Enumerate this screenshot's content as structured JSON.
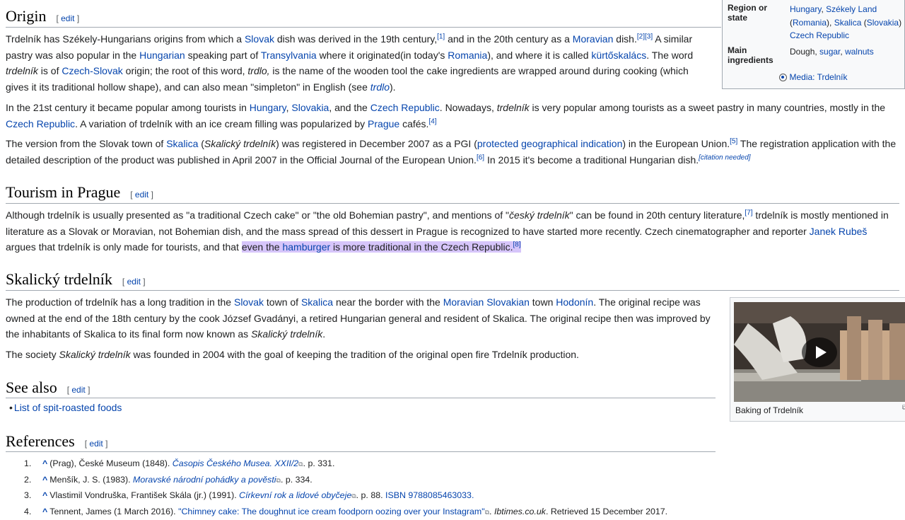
{
  "infobox": {
    "region_label": "Region or state",
    "region_values": [
      "Hungary",
      ", ",
      "Székely Land",
      " (",
      "Romania",
      "), ",
      "Skalica",
      " (",
      "Slovakia",
      ")",
      "Czech Republic"
    ],
    "ingredients_label": "Main ingredients",
    "ingredients_plain": "Dough, ",
    "ingredients_links": [
      "sugar",
      "walnuts"
    ],
    "ingredients_sep": ", ",
    "media": "Media: Trdelník"
  },
  "origin": {
    "heading": "Origin",
    "edit": "edit",
    "p1": {
      "t1": "Trdelník has Székely-Hungarians origins from which a ",
      "l1": "Slovak",
      "t2": " dish was derived in the 19th century,",
      "s1": "[1]",
      "t3": " and in the 20th century as a ",
      "l2": "Moravian",
      "t4": " dish.",
      "s2": "[2]",
      "s3": "[3]",
      "t5": " A similar pastry was also popular in the ",
      "l3": "Hungarian",
      "t6": " speaking part of ",
      "l4": "Transylvania",
      "t7": " where it originated(in today's ",
      "l5": "Romania",
      "t8": "), and where it is called ",
      "l6": "kürtőskalács",
      "t9": ". The word ",
      "i1": "trdelník",
      "t10": " is of ",
      "l7": "Czech-Slovak",
      "t11": " origin; the root of this word, ",
      "i2": "trdlo,",
      "t12": " is the name of the wooden tool the cake ingredients are wrapped around during cooking (which gives it its traditional hollow shape), and can also mean \"simpleton\" in English (see ",
      "l8": "trdlo",
      "t13": ")."
    },
    "p2": {
      "t1": "In the 21st century it became popular among tourists in ",
      "l1": "Hungary",
      "c1": ", ",
      "l2": "Slovakia",
      "t2": ", and the ",
      "l3": "Czech Republic",
      "t3": ". Nowadays, ",
      "i1": "trdelník",
      "t4": " is very popular among tourists as a sweet pastry in many countries, mostly in the ",
      "l4": "Czech Republic",
      "t5": ". A variation of trdelník with an ice cream filling was popularized by ",
      "l5": "Prague",
      "t6": " cafés.",
      "s1": "[4]"
    },
    "p3": {
      "t1": "The version from the Slovak town of ",
      "l1": "Skalica",
      "t2": " (",
      "i1": "Skalický trdelník",
      "t3": ") was registered in December 2007 as a PGI (",
      "l2": "protected geographical indication",
      "t4": ") in the European Union.",
      "s1": "[5]",
      "t5": " The registration application with the detailed description of the product was published in April 2007 in the Official Journal of the European Union.",
      "s2": "[6]",
      "t6": " In 2015 it's become a traditional Hungarian dish.",
      "s3": "[citation needed]"
    }
  },
  "tourism": {
    "heading": "Tourism in Prague",
    "edit": "edit",
    "p1": {
      "t1": "Although trdelník is usually presented as \"a traditional Czech cake\" or \"the old Bohemian pastry\", and mentions of \"",
      "i1": "český trdelník",
      "t2": "\" can be found in 20th century literature,",
      "s1": "[7]",
      "t3": " trdelník is mostly mentioned in literature as a Slovak or Moravian, not Bohemian dish, and the mass spread of this dessert in Prague is recognized to have started more recently. Czech cinematographer and reporter ",
      "l1": "Janek Rubeš",
      "t4": " argues that trdelník is only made for tourists, and that ",
      "h1": "even the ",
      "hl": "hamburger",
      "h2": " is more traditional in the Czech Republic.",
      "s2": "[8]"
    }
  },
  "skalicky": {
    "heading": "Skalický trdelník",
    "edit": "edit",
    "p1": {
      "t1": "The production of trdelník has a long tradition in the ",
      "l1": "Slovak",
      "t2": " town of ",
      "l2": "Skalica",
      "t3": " near the border with the ",
      "l3": "Moravian Slovakian",
      "t4": " town ",
      "l4": "Hodonín",
      "t5": ". The original recipe was owned at the end of the 18th century by the cook József Gvadányi, a retired Hungarian general and resident of Skalica. The original recipe then was improved by the inhabitants of Skalica to its final form now known as ",
      "i1": "Skalický trdelník",
      "t6": "."
    },
    "p2": {
      "t1": "The society ",
      "i1": "Skalický trdelník",
      "t2": " was founded in 2004 with the goal of keeping the tradition of the original open fire Trdelník production."
    },
    "video_caption": "Baking of Trdelník"
  },
  "see_also": {
    "heading": "See also",
    "edit": "edit",
    "items": [
      "List of spit-roasted foods"
    ]
  },
  "references": {
    "heading": "References",
    "edit": "edit",
    "items": [
      {
        "num": "1.",
        "caret": "^",
        "pre": "(Prag), České Museum (1848). ",
        "title": "Časopis Českého Musea. XXII/2",
        "post": ". p. 331."
      },
      {
        "num": "2.",
        "caret": "^",
        "pre": "Menšík, J. S. (1983). ",
        "title": "Moravské národní pohádky a pověsti",
        "post": ". p. 334."
      },
      {
        "num": "3.",
        "caret": "^",
        "pre": "Vlastimil Vondruška, František Skála (jr.) (1991). ",
        "title": "Církevní rok a lidové obyčeje",
        "post": ". p. 88. ",
        "isbn": "ISBN 9788085463033."
      },
      {
        "num": "4.",
        "caret": "^",
        "pre": "Tennent, James (1 March 2016). ",
        "title": "\"Chimney cake: The doughnut ice cream foodporn oozing over your Instagram\"",
        "post": ". ",
        "site": "Ibtimes.co.uk",
        "post2": ". Retrieved 15 December 2017."
      }
    ]
  },
  "colors": {
    "link": "#0645ad",
    "highlight": "#d6c5fa",
    "rule": "#a2a9b1"
  }
}
